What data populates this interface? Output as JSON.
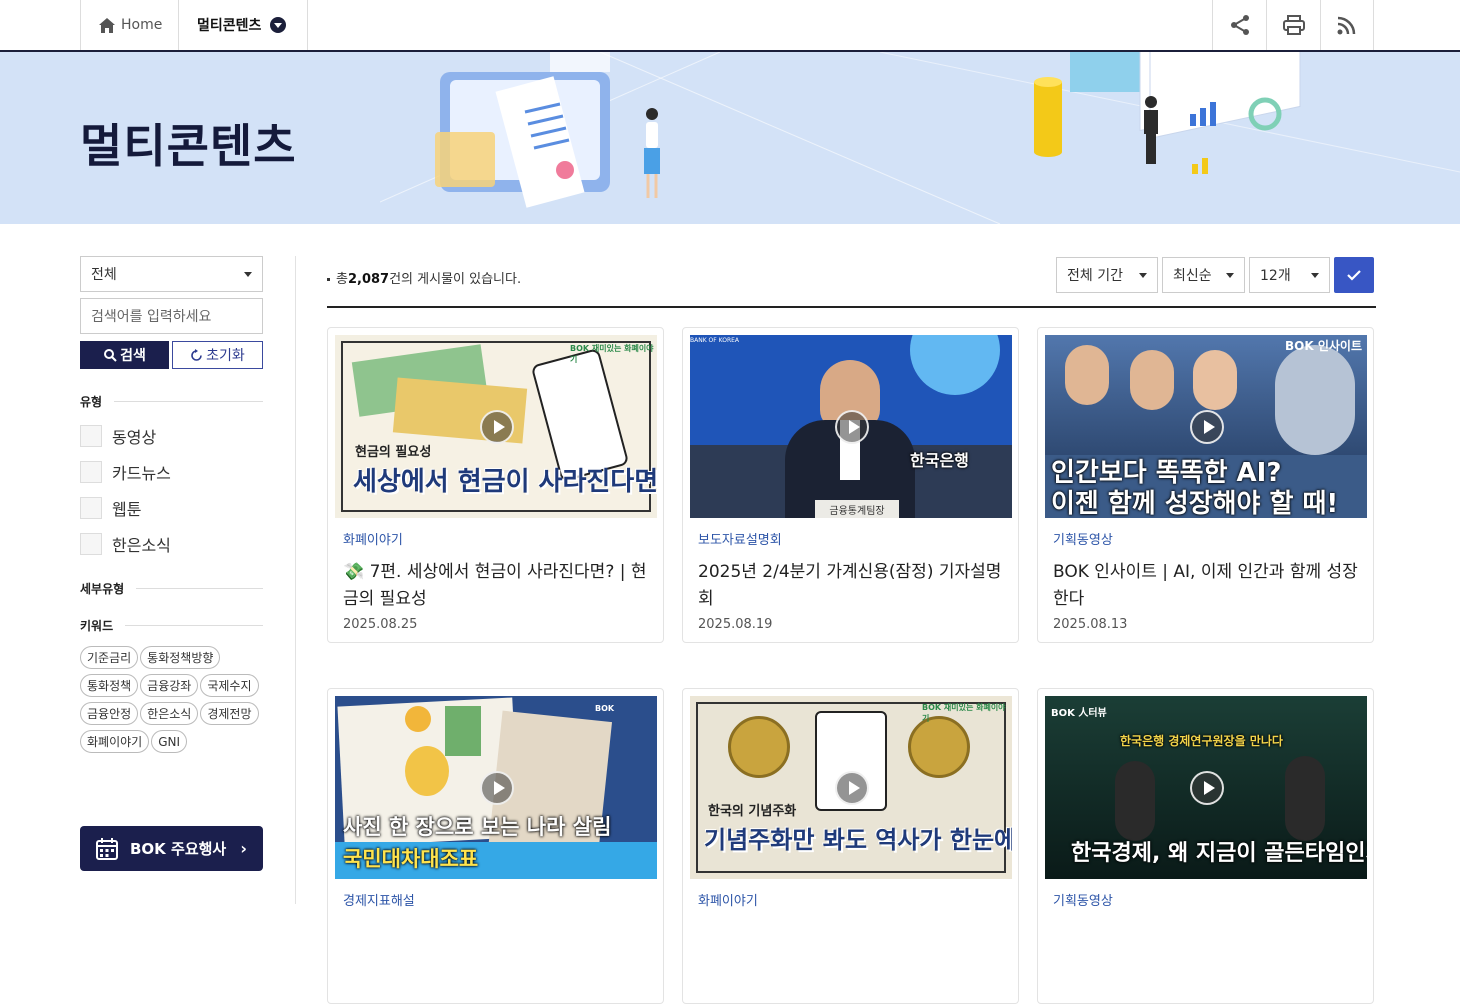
{
  "nav": {
    "home_label": "Home",
    "current_label": "멀티콘텐츠",
    "tools": [
      "share-icon",
      "print-icon",
      "rss-icon"
    ]
  },
  "banner": {
    "title": "멀티콘텐츠"
  },
  "sidebar": {
    "category_select": "전체",
    "search_placeholder": "검색어를 입력하세요",
    "search_button": "검색",
    "reset_button": "초기화",
    "type_heading": "유형",
    "types": [
      "동영상",
      "카드뉴스",
      "웹툰",
      "한은소식"
    ],
    "subtype_heading": "세부유형",
    "keyword_heading": "키워드",
    "keywords": [
      "기준금리",
      "통화정책방향",
      "통화정책",
      "금융강좌",
      "국제수지",
      "금융안정",
      "한은소식",
      "경제전망",
      "화폐이야기",
      "GNI"
    ],
    "event_button": "BOK 주요행사"
  },
  "list": {
    "count_prefix": "총",
    "count_value": "2,087",
    "count_suffix": "건의 게시물이 있습니다.",
    "period_filter": "전체 기간",
    "sort_filter": "최신순",
    "page_size_filter": "12개",
    "items": [
      {
        "category": "화폐이야기",
        "title": "💸 7편. 세상에서 현금이 사라진다면? | 현금의 필요성",
        "date": "2025.08.25",
        "thumb_caption": "세상에서 현금이 사라진다면?",
        "thumb_sub": "현금의 필요성",
        "thumb_badge": "BOK 재미있는 화폐이야기"
      },
      {
        "category": "보도자료설명회",
        "title": "2025년 2/4분기 가계신용(잠정) 기자설명회",
        "date": "2025.08.19",
        "thumb_caption": "금융통계팀장",
        "thumb_sub": "한국은행",
        "thumb_badge": "BANK OF KOREA"
      },
      {
        "category": "기획동영상",
        "title": "BOK 인사이트 | AI, 이제 인간과 함께 성장한다",
        "date": "2025.08.13",
        "thumb_caption": "인간보다 똑똑한 AI?",
        "thumb_sub": "이젠 함께 성장해야 할 때!",
        "thumb_badge": "BOK 인사이트"
      },
      {
        "category": "경제지표해설",
        "title": "사진 한 장으로 보는 나라 살림 국민대차대조표",
        "date": "",
        "thumb_caption": "사진 한 장으로 보는 나라 살림",
        "thumb_sub": "국민대차대조표",
        "thumb_badge": "BOK"
      },
      {
        "category": "화폐이야기",
        "title": "기념주화만 봐도 역사가 한눈에?!",
        "date": "",
        "thumb_caption": "기념주화만 봐도 역사가 한눈에?!",
        "thumb_sub": "한국의 기념주화",
        "thumb_badge": "BOK 재미있는 화폐이야기"
      },
      {
        "category": "기획동영상",
        "title": "한국경제, 왜 지금이 골든타임인가?",
        "date": "",
        "thumb_caption": "한국경제, 왜 지금이 골든타임인가?",
        "thumb_sub": "한국은행 경제연구원장을 만나다",
        "thumb_badge": "BOK 人터뷰"
      }
    ]
  }
}
